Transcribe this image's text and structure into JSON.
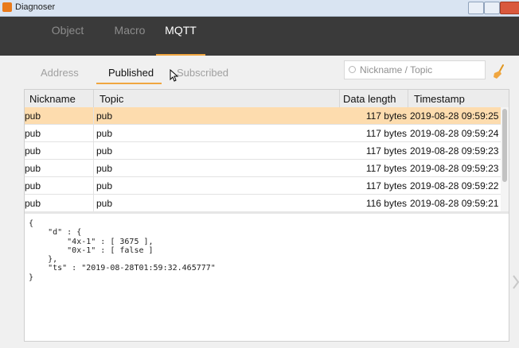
{
  "window": {
    "title": "Diagnoser"
  },
  "tabs": [
    {
      "label": "Object",
      "active": false
    },
    {
      "label": "Macro",
      "active": false
    },
    {
      "label": "MQTT",
      "active": true
    }
  ],
  "subtabs": [
    {
      "label": "Address",
      "active": false
    },
    {
      "label": "Published",
      "active": true
    },
    {
      "label": "Subscribed",
      "active": false
    }
  ],
  "search": {
    "placeholder": "Nickname / Topic",
    "value": ""
  },
  "table": {
    "headers": {
      "nickname": "Nickname",
      "topic": "Topic",
      "data_length": "Data length",
      "timestamp": "Timestamp"
    },
    "rows": [
      {
        "nickname": "pub",
        "topic": "pub",
        "data_length": "117 bytes",
        "timestamp": "2019-08-28 09:59:25",
        "selected": true
      },
      {
        "nickname": "pub",
        "topic": "pub",
        "data_length": "117 bytes",
        "timestamp": "2019-08-28 09:59:24"
      },
      {
        "nickname": "pub",
        "topic": "pub",
        "data_length": "117 bytes",
        "timestamp": "2019-08-28 09:59:23"
      },
      {
        "nickname": "pub",
        "topic": "pub",
        "data_length": "117 bytes",
        "timestamp": "2019-08-28 09:59:23"
      },
      {
        "nickname": "pub",
        "topic": "pub",
        "data_length": "117 bytes",
        "timestamp": "2019-08-28 09:59:22"
      },
      {
        "nickname": "pub",
        "topic": "pub",
        "data_length": "116 bytes",
        "timestamp": "2019-08-28 09:59:21"
      }
    ]
  },
  "payload": "{\n    \"d\" : {\n        \"4x-1\" : [ 3675 ],\n        \"0x-1\" : [ false ]\n    },\n    \"ts\" : \"2019-08-28T01:59:32.465777\"\n}",
  "colors": {
    "accent": "#f0a640",
    "selected_row": "#fddcae",
    "tabbar": "#3a3a3a"
  },
  "icons": {
    "app": "app-icon",
    "search": "search-icon",
    "clear": "broom-icon",
    "cursor": "pointer-cursor-icon"
  }
}
